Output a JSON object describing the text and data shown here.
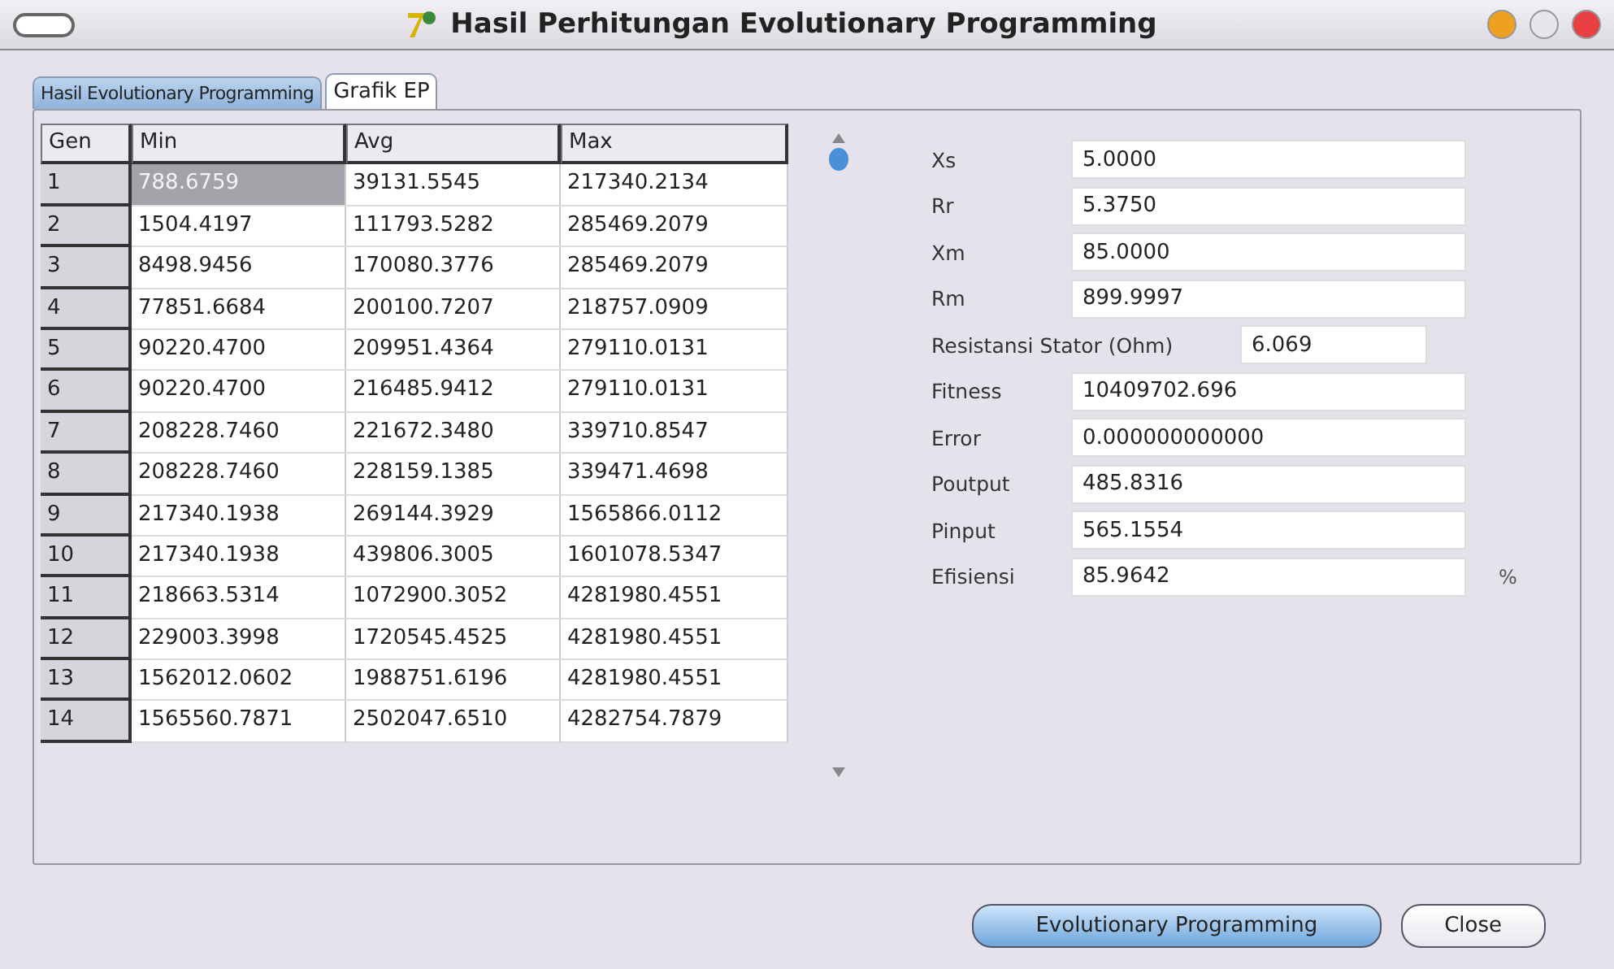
{
  "window": {
    "title": "Hasil Perhitungan Evolutionary Programming"
  },
  "tabs": [
    {
      "label": "Hasil Evolutionary Programming",
      "selected": true
    },
    {
      "label": "Grafik EP",
      "selected": false
    }
  ],
  "table": {
    "columns": [
      "Gen",
      "Min",
      "Avg",
      "Max"
    ],
    "rows": [
      {
        "cells": [
          "1",
          "788.6759",
          "39131.5545",
          "217340.2134"
        ],
        "selected": true
      },
      {
        "cells": [
          "2",
          "1504.4197",
          "111793.5282",
          "285469.2079"
        ],
        "selected": false
      },
      {
        "cells": [
          "3",
          "8498.9456",
          "170080.3776",
          "285469.2079"
        ],
        "selected": false
      },
      {
        "cells": [
          "4",
          "77851.6684",
          "200100.7207",
          "218757.0909"
        ],
        "selected": false
      },
      {
        "cells": [
          "5",
          "90220.4700",
          "209951.4364",
          "279110.0131"
        ],
        "selected": false
      },
      {
        "cells": [
          "6",
          "90220.4700",
          "216485.9412",
          "279110.0131"
        ],
        "selected": false
      },
      {
        "cells": [
          "7",
          "208228.7460",
          "221672.3480",
          "339710.8547"
        ],
        "selected": false
      },
      {
        "cells": [
          "8",
          "208228.7460",
          "228159.1385",
          "339471.4698"
        ],
        "selected": false
      },
      {
        "cells": [
          "9",
          "217340.1938",
          "269144.3929",
          "1565866.0112"
        ],
        "selected": false
      },
      {
        "cells": [
          "10",
          "217340.1938",
          "439806.3005",
          "1601078.5347"
        ],
        "selected": false
      },
      {
        "cells": [
          "11",
          "218663.5314",
          "1072900.3052",
          "4281980.4551"
        ],
        "selected": false
      },
      {
        "cells": [
          "12",
          "229003.3998",
          "1720545.4525",
          "4281980.4551"
        ],
        "selected": false
      },
      {
        "cells": [
          "13",
          "1562012.0602",
          "1988751.6196",
          "4281980.4551"
        ],
        "selected": false
      },
      {
        "cells": [
          "14",
          "1565560.7871",
          "2502047.6510",
          "4282754.7879"
        ],
        "selected": false
      }
    ]
  },
  "fields": [
    {
      "label": "Xs",
      "value": "5.0000",
      "kind": "normal"
    },
    {
      "label": "Rr",
      "value": "5.3750",
      "kind": "normal"
    },
    {
      "label": "Xm",
      "value": "85.0000",
      "kind": "normal"
    },
    {
      "label": "Rm",
      "value": "899.9997",
      "kind": "normal"
    },
    {
      "label": "Resistansi Stator (Ohm)",
      "value": "6.069",
      "kind": "wide-label"
    },
    {
      "label": "Fitness",
      "value": "10409702.696",
      "kind": "normal"
    },
    {
      "label": "Error",
      "value": "0.000000000000",
      "kind": "normal"
    },
    {
      "label": "Poutput",
      "value": "485.8316",
      "kind": "normal"
    },
    {
      "label": "Pinput",
      "value": "565.1554",
      "kind": "normal"
    },
    {
      "label": "Efisiensi",
      "value": "85.9642",
      "kind": "normal",
      "unit": "%"
    }
  ],
  "buttons": [
    {
      "label": "Evolutionary Programming",
      "kind": "primary"
    },
    {
      "label": "Close",
      "kind": "secondary"
    }
  ]
}
